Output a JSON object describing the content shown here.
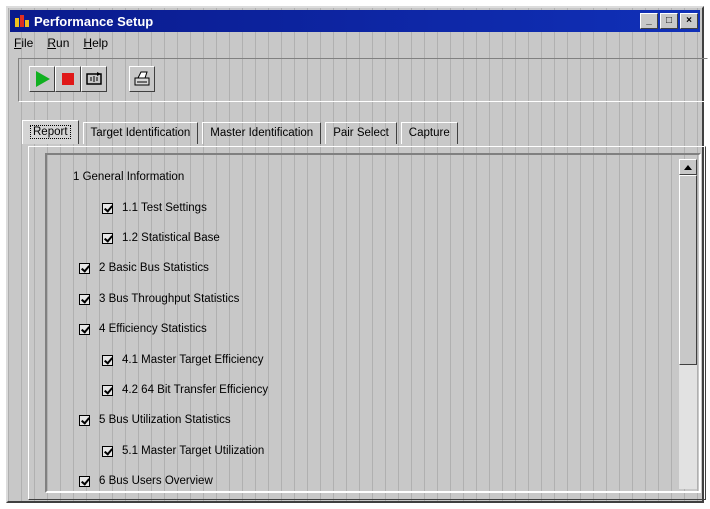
{
  "window": {
    "title": "Performance Setup"
  },
  "window_buttons": {
    "minimize": "_",
    "maximize": "□",
    "close": "×"
  },
  "menu": {
    "items": [
      {
        "hotkey": "F",
        "rest": "ile"
      },
      {
        "hotkey": "R",
        "rest": "un"
      },
      {
        "hotkey": "H",
        "rest": "elp"
      }
    ]
  },
  "toolbar": {
    "icons": [
      "run-icon",
      "stop-icon",
      "loop-icon",
      "print-icon"
    ],
    "colors": {
      "run": "#10b020",
      "stop": "#e01818"
    }
  },
  "tabs": [
    {
      "label": "Report",
      "active": true
    },
    {
      "label": "Target Identification",
      "active": false
    },
    {
      "label": "Master Identification",
      "active": false
    },
    {
      "label": "Pair Select",
      "active": false
    },
    {
      "label": "Capture",
      "active": false
    }
  ],
  "report_tree": [
    {
      "label": "1 General Information",
      "checked": false,
      "level": 0
    },
    {
      "label": "1.1 Test Settings",
      "checked": true,
      "level": 1
    },
    {
      "label": "1.2 Statistical Base",
      "checked": true,
      "level": 1
    },
    {
      "label": "2 Basic Bus Statistics",
      "checked": true,
      "level": 0
    },
    {
      "label": "3 Bus Throughput Statistics",
      "checked": true,
      "level": 0
    },
    {
      "label": "4 Efficiency Statistics",
      "checked": true,
      "level": 0
    },
    {
      "label": "4.1 Master Target Efficiency",
      "checked": true,
      "level": 1
    },
    {
      "label": "4.2 64 Bit Transfer Efficiency",
      "checked": true,
      "level": 1
    },
    {
      "label": "5 Bus Utilization Statistics",
      "checked": true,
      "level": 0
    },
    {
      "label": "5.1 Master Target Utilization",
      "checked": true,
      "level": 1
    },
    {
      "label": "6 Bus Users Overview",
      "checked": true,
      "level": 0
    }
  ]
}
